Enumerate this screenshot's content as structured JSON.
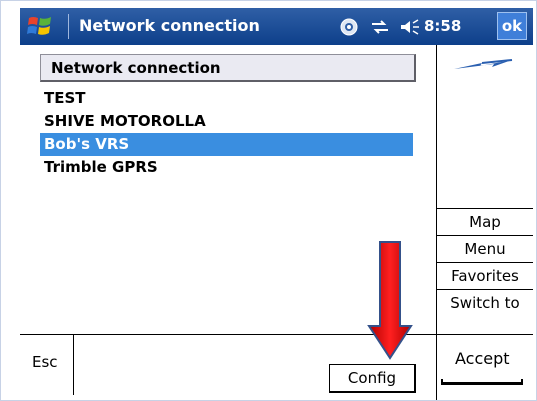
{
  "titlebar": {
    "title": "Network connection",
    "time": "8:58",
    "ok_label": "ok",
    "icons": [
      "windows-start-icon",
      "sync-icon",
      "connectivity-icon",
      "speaker-icon"
    ]
  },
  "list": {
    "header": "Network connection",
    "items": [
      {
        "label": "TEST",
        "selected": false
      },
      {
        "label": "SHIVE MOTOROLLA",
        "selected": false
      },
      {
        "label": "Bob's VRS",
        "selected": true
      },
      {
        "label": "Trimble GPRS",
        "selected": false
      }
    ]
  },
  "sidebar": {
    "map": "Map",
    "menu": "Menu",
    "favorites": "Favorites",
    "switch_to": "Switch to"
  },
  "bottom": {
    "esc": "Esc",
    "config": "Config",
    "accept": "Accept"
  },
  "colors": {
    "titlebar": "#0d3f8a",
    "selection": "#3a8ee0",
    "arrow": "#e00000"
  }
}
